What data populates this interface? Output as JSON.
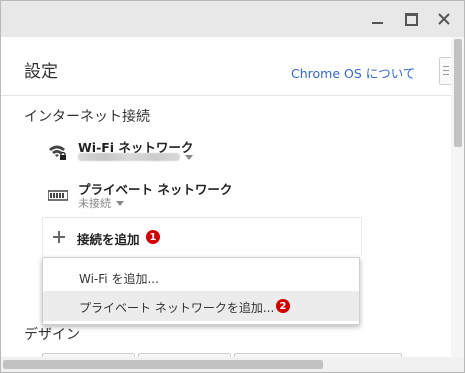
{
  "window": {
    "controls": [
      "minimize-icon",
      "maximize-icon",
      "close-icon"
    ]
  },
  "header": {
    "title": "設定",
    "about_link": "Chrome OS について"
  },
  "internet": {
    "section_title": "インターネット接続",
    "networks": [
      {
        "name": "Wi-Fi ネットワーク",
        "icon": "wifi-lock-icon",
        "status": ""
      },
      {
        "name": "プライベート ネットワーク",
        "icon": "vpn-icon",
        "status": "未接続"
      }
    ],
    "add_connection": {
      "label": "接続を追加",
      "badge": "1"
    },
    "menu": [
      {
        "label": "Wi-Fi を追加..."
      },
      {
        "label": "プライベート ネットワークを追加...",
        "badge": "2"
      }
    ]
  },
  "design": {
    "section_title": "デザイン"
  },
  "colors": {
    "link": "#3367d6",
    "badge": "#d40000"
  }
}
